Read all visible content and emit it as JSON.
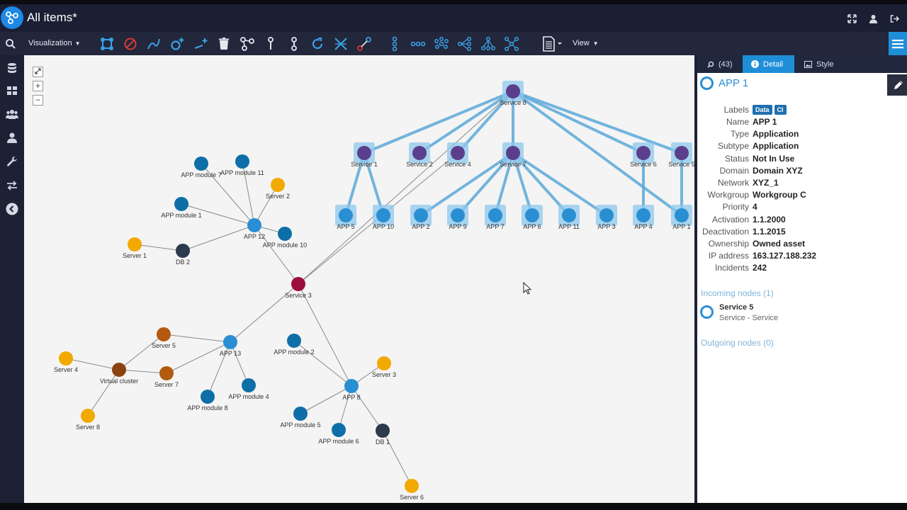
{
  "header": {
    "title": "All items*"
  },
  "toolbar": {
    "visualization_label": "Visualization",
    "view_label": "View"
  },
  "graph_nodes": [
    {
      "id": "service8",
      "label": "Service 8",
      "kind": "service",
      "color": "#5b3f8c",
      "boxed": true
    },
    {
      "id": "service1",
      "label": "Service 1",
      "kind": "service",
      "color": "#5b3f8c",
      "boxed": true
    },
    {
      "id": "service2",
      "label": "Service 2",
      "kind": "service",
      "color": "#5b3f8c",
      "boxed": true
    },
    {
      "id": "service4",
      "label": "Service 4",
      "kind": "service",
      "color": "#5b3f8c",
      "boxed": true
    },
    {
      "id": "service7",
      "label": "Service 7",
      "kind": "service",
      "color": "#5b3f8c",
      "boxed": true
    },
    {
      "id": "service6",
      "label": "Service 6",
      "kind": "service",
      "color": "#5b3f8c",
      "boxed": true
    },
    {
      "id": "service5",
      "label": "Service 5",
      "kind": "service",
      "color": "#5b3f8c",
      "boxed": true
    },
    {
      "id": "app5",
      "label": "APP 5",
      "kind": "app",
      "color": "#2a8fd2",
      "boxed": true
    },
    {
      "id": "app10",
      "label": "APP 10",
      "kind": "app",
      "color": "#2a8fd2",
      "boxed": true
    },
    {
      "id": "app2",
      "label": "APP 2",
      "kind": "app",
      "color": "#2a8fd2",
      "boxed": true
    },
    {
      "id": "app9",
      "label": "APP 9",
      "kind": "app",
      "color": "#2a8fd2",
      "boxed": true
    },
    {
      "id": "app7",
      "label": "APP 7",
      "kind": "app",
      "color": "#2a8fd2",
      "boxed": true
    },
    {
      "id": "app6",
      "label": "APP 6",
      "kind": "app",
      "color": "#2a8fd2",
      "boxed": true
    },
    {
      "id": "app11",
      "label": "APP 11",
      "kind": "app",
      "color": "#2a8fd2",
      "boxed": true
    },
    {
      "id": "app3",
      "label": "APP 3",
      "kind": "app",
      "color": "#2a8fd2",
      "boxed": true
    },
    {
      "id": "app4",
      "label": "APP 4",
      "kind": "app",
      "color": "#2a8fd2",
      "boxed": true
    },
    {
      "id": "app1",
      "label": "APP 1",
      "kind": "app",
      "color": "#2a8fd2",
      "boxed": true
    },
    {
      "id": "appmod7",
      "label": "APP module 7",
      "kind": "module",
      "color": "#0e6fa8"
    },
    {
      "id": "appmod11",
      "label": "APP module 11",
      "kind": "module",
      "color": "#0e6fa8"
    },
    {
      "id": "server2",
      "label": "Server 2",
      "kind": "server",
      "color": "#f2a900"
    },
    {
      "id": "appmod1",
      "label": "APP module 1",
      "kind": "module",
      "color": "#0e6fa8"
    },
    {
      "id": "app12",
      "label": "APP 12",
      "kind": "app",
      "color": "#2a8fd2"
    },
    {
      "id": "appmod10",
      "label": "APP module 10",
      "kind": "module",
      "color": "#0e6fa8"
    },
    {
      "id": "server1",
      "label": "Server 1",
      "kind": "server",
      "color": "#f2a900"
    },
    {
      "id": "db2",
      "label": "DB 2",
      "kind": "db",
      "color": "#2c3a4e"
    },
    {
      "id": "service3",
      "label": "Service 3",
      "kind": "service",
      "color": "#9b0e3e"
    },
    {
      "id": "server5",
      "label": "Server 5",
      "kind": "vserver",
      "color": "#b35a10"
    },
    {
      "id": "app13",
      "label": "APP 13",
      "kind": "app",
      "color": "#2a8fd2"
    },
    {
      "id": "appmod2",
      "label": "APP module 2",
      "kind": "module",
      "color": "#0e6fa8"
    },
    {
      "id": "server4",
      "label": "Server 4",
      "kind": "server",
      "color": "#f2a900"
    },
    {
      "id": "vcluster",
      "label": "Virtual cluster",
      "kind": "vcluster",
      "color": "#8a4310"
    },
    {
      "id": "server7",
      "label": "Server 7",
      "kind": "vserver",
      "color": "#b35a10"
    },
    {
      "id": "server3",
      "label": "Server 3",
      "kind": "server",
      "color": "#f2a900"
    },
    {
      "id": "app8",
      "label": "APP 8",
      "kind": "app",
      "color": "#2a8fd2"
    },
    {
      "id": "appmod4",
      "label": "APP module 4",
      "kind": "module",
      "color": "#0e6fa8"
    },
    {
      "id": "appmod8",
      "label": "APP module 8",
      "kind": "module",
      "color": "#0e6fa8"
    },
    {
      "id": "server8",
      "label": "Server 8",
      "kind": "server",
      "color": "#f2a900"
    },
    {
      "id": "appmod5",
      "label": "APP module 5",
      "kind": "module",
      "color": "#0e6fa8"
    },
    {
      "id": "appmod6",
      "label": "APP module 6",
      "kind": "module",
      "color": "#0e6fa8"
    },
    {
      "id": "db1",
      "label": "DB 1",
      "kind": "db",
      "color": "#2c3a4e"
    },
    {
      "id": "server6",
      "label": "Server 6",
      "kind": "server",
      "color": "#f2a900"
    }
  ],
  "graph_edges": [
    {
      "from": "service8",
      "to": "service1",
      "highlight": true
    },
    {
      "from": "service8",
      "to": "service2",
      "highlight": true
    },
    {
      "from": "service8",
      "to": "service4",
      "highlight": true
    },
    {
      "from": "service8",
      "to": "service7",
      "highlight": true
    },
    {
      "from": "service8",
      "to": "service6",
      "highlight": true
    },
    {
      "from": "service8",
      "to": "service5",
      "highlight": true
    },
    {
      "from": "service8",
      "to": "app1",
      "highlight": true
    },
    {
      "from": "service1",
      "to": "app5",
      "highlight": true
    },
    {
      "from": "service1",
      "to": "app10",
      "highlight": true
    },
    {
      "from": "service7",
      "to": "app2",
      "highlight": true
    },
    {
      "from": "service7",
      "to": "app9",
      "highlight": true
    },
    {
      "from": "service7",
      "to": "app7",
      "highlight": true
    },
    {
      "from": "service7",
      "to": "app6",
      "highlight": true
    },
    {
      "from": "service7",
      "to": "app11",
      "highlight": true
    },
    {
      "from": "service7",
      "to": "app3",
      "highlight": true
    },
    {
      "from": "service6",
      "to": "app4",
      "highlight": true
    },
    {
      "from": "service5",
      "to": "app1",
      "highlight": true
    },
    {
      "from": "service3",
      "to": "service8",
      "highlight": false
    },
    {
      "from": "service3",
      "to": "service4",
      "highlight": false
    },
    {
      "from": "service3",
      "to": "app12",
      "highlight": false
    },
    {
      "from": "service3",
      "to": "app13",
      "highlight": false
    },
    {
      "from": "service3",
      "to": "app8",
      "highlight": false
    },
    {
      "from": "app12",
      "to": "appmod7",
      "highlight": false
    },
    {
      "from": "app12",
      "to": "appmod11",
      "highlight": false
    },
    {
      "from": "app12",
      "to": "server2",
      "highlight": false
    },
    {
      "from": "app12",
      "to": "appmod1",
      "highlight": false
    },
    {
      "from": "app12",
      "to": "appmod10",
      "highlight": false
    },
    {
      "from": "app12",
      "to": "db2",
      "highlight": false
    },
    {
      "from": "db2",
      "to": "server1",
      "highlight": false
    },
    {
      "from": "app13",
      "to": "server5",
      "highlight": false
    },
    {
      "from": "app13",
      "to": "server7",
      "highlight": false
    },
    {
      "from": "app13",
      "to": "appmod4",
      "highlight": false
    },
    {
      "from": "app13",
      "to": "appmod8",
      "highlight": false
    },
    {
      "from": "vcluster",
      "to": "server5",
      "highlight": false
    },
    {
      "from": "vcluster",
      "to": "server7",
      "highlight": false
    },
    {
      "from": "vcluster",
      "to": "server4",
      "highlight": false
    },
    {
      "from": "vcluster",
      "to": "server8",
      "highlight": false
    },
    {
      "from": "app8",
      "to": "appmod2",
      "highlight": false
    },
    {
      "from": "app8",
      "to": "server3",
      "highlight": false
    },
    {
      "from": "app8",
      "to": "appmod5",
      "highlight": false
    },
    {
      "from": "app8",
      "to": "appmod6",
      "highlight": false
    },
    {
      "from": "app8",
      "to": "db1",
      "highlight": false
    },
    {
      "from": "db1",
      "to": "server6",
      "highlight": false
    }
  ],
  "panel": {
    "tabs": [
      {
        "label": "(43)",
        "icon": "search-icon"
      },
      {
        "label": "Detail",
        "icon": "info-icon"
      },
      {
        "label": "Style",
        "icon": "image-icon"
      }
    ],
    "title": "APP 1",
    "labels_key": "Labels",
    "chips": [
      "Data",
      "CI"
    ],
    "props": [
      {
        "key": "Name",
        "value": "APP 1"
      },
      {
        "key": "Type",
        "value": "Application"
      },
      {
        "key": "Subtype",
        "value": "Application"
      },
      {
        "key": "Status",
        "value": "Not In Use"
      },
      {
        "key": "Domain",
        "value": "Domain XYZ"
      },
      {
        "key": "Network",
        "value": "XYZ_1"
      },
      {
        "key": "Workgroup",
        "value": "Workgroup C"
      },
      {
        "key": "Priority",
        "value": "4"
      },
      {
        "key": "Activation",
        "value": "1.1.2000"
      },
      {
        "key": "Deactivation",
        "value": "1.1.2015"
      },
      {
        "key": "Ownership",
        "value": "Owned asset"
      },
      {
        "key": "IP address",
        "value": "163.127.188.232"
      },
      {
        "key": "Incidents",
        "value": "242"
      }
    ],
    "incoming_label": "Incoming nodes (1)",
    "incoming_node": {
      "name": "Service 5",
      "sub": "Service - Service"
    },
    "outgoing_label": "Outgoing nodes (0)"
  },
  "colors": {
    "accent": "#1f8ed8",
    "highlight_edge": "#5aa8d8",
    "plain_edge": "#8a8a8a"
  }
}
